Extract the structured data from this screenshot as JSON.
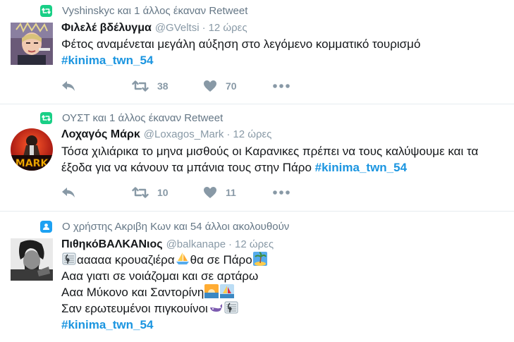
{
  "tweets": [
    {
      "context": "Vyshinskyc και 1 άλλος έκαναν Retweet",
      "context_icon": "retweet-icon",
      "fullname": "Φιλελέ βδέλυγμα",
      "handle": "@GVeltsi",
      "dot": "·",
      "time": "12 ώρες",
      "text": "Φέτος αναμένεται μεγάλη αύξηση στο λεγόμενο κομματικό τουρισμό",
      "hashtag": "#kinima_twn_54",
      "retweets": "38",
      "likes": "70"
    },
    {
      "context": "ΟΥΣΤ και 1 άλλος έκαναν Retweet",
      "context_icon": "retweet-icon",
      "fullname": "Λοχαγός Μάρκ",
      "handle": "@Loxagos_Mark",
      "dot": "·",
      "time": "12 ώρες",
      "text_line1": "Τόσα χιλιάρικα το μηνα μισθούς οι Καρανικες πρέπει να τους καλύψουμε και τα",
      "text_line2": "έξοδα για να κάνουν τα μπάνια τους στην Πάρο",
      "hashtag": "#kinima_twn_54",
      "avatar_text": "MARK",
      "retweets": "10",
      "likes": "11"
    },
    {
      "context": "Ο χρήστης Ακριβη Κων και 54 άλλοι ακολουθούν",
      "context_icon": "follow-icon",
      "fullname": "ΠιθηκόΒΑΛΚΑΝιος",
      "handle": "@balkanape",
      "dot": "·",
      "time": "12 ώρες",
      "line1a": "ααααα κρουαζιέρα",
      "line1b": "θα σε Πάρο",
      "line2": "Ααα γιατι σε νοιάζομαι και σε αρτάρω",
      "line3": "Ααα Μύκονο και Σαντορίνη",
      "line4": "Σαν ερωτευμένοι πιγκουίνοι",
      "hashtag": "#kinima_twn_54"
    }
  ],
  "colors": {
    "accent": "#1da1f2",
    "hashtag": "#1b95e0",
    "retweet": "#19cf86",
    "muted": "#8899a6",
    "text": "#14171a"
  }
}
